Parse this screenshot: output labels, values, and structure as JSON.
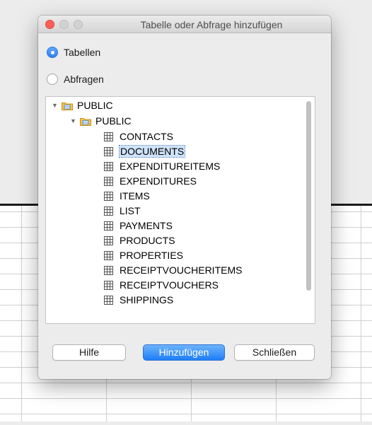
{
  "dialog": {
    "title": "Tabelle oder Abfrage hinzufügen",
    "radio_tables": "Tabellen",
    "radio_queries": "Abfragen",
    "selected_radio": "Tabellen"
  },
  "tree": {
    "root": "PUBLIC",
    "schema": "PUBLIC",
    "tables": [
      "CONTACTS",
      "DOCUMENTS",
      "EXPENDITUREITEMS",
      "EXPENDITURES",
      "ITEMS",
      "LIST",
      "PAYMENTS",
      "PRODUCTS",
      "PROPERTIES",
      "RECEIPTVOUCHERITEMS",
      "RECEIPTVOUCHERS",
      "SHIPPINGS"
    ],
    "selected_table": "DOCUMENTS"
  },
  "buttons": {
    "help": "Hilfe",
    "add": "Hinzufügen",
    "close": "Schließen"
  },
  "colors": {
    "accent": "#2e7ff3",
    "close_light": "#fc5f57",
    "selection": "#cfe3fb"
  }
}
